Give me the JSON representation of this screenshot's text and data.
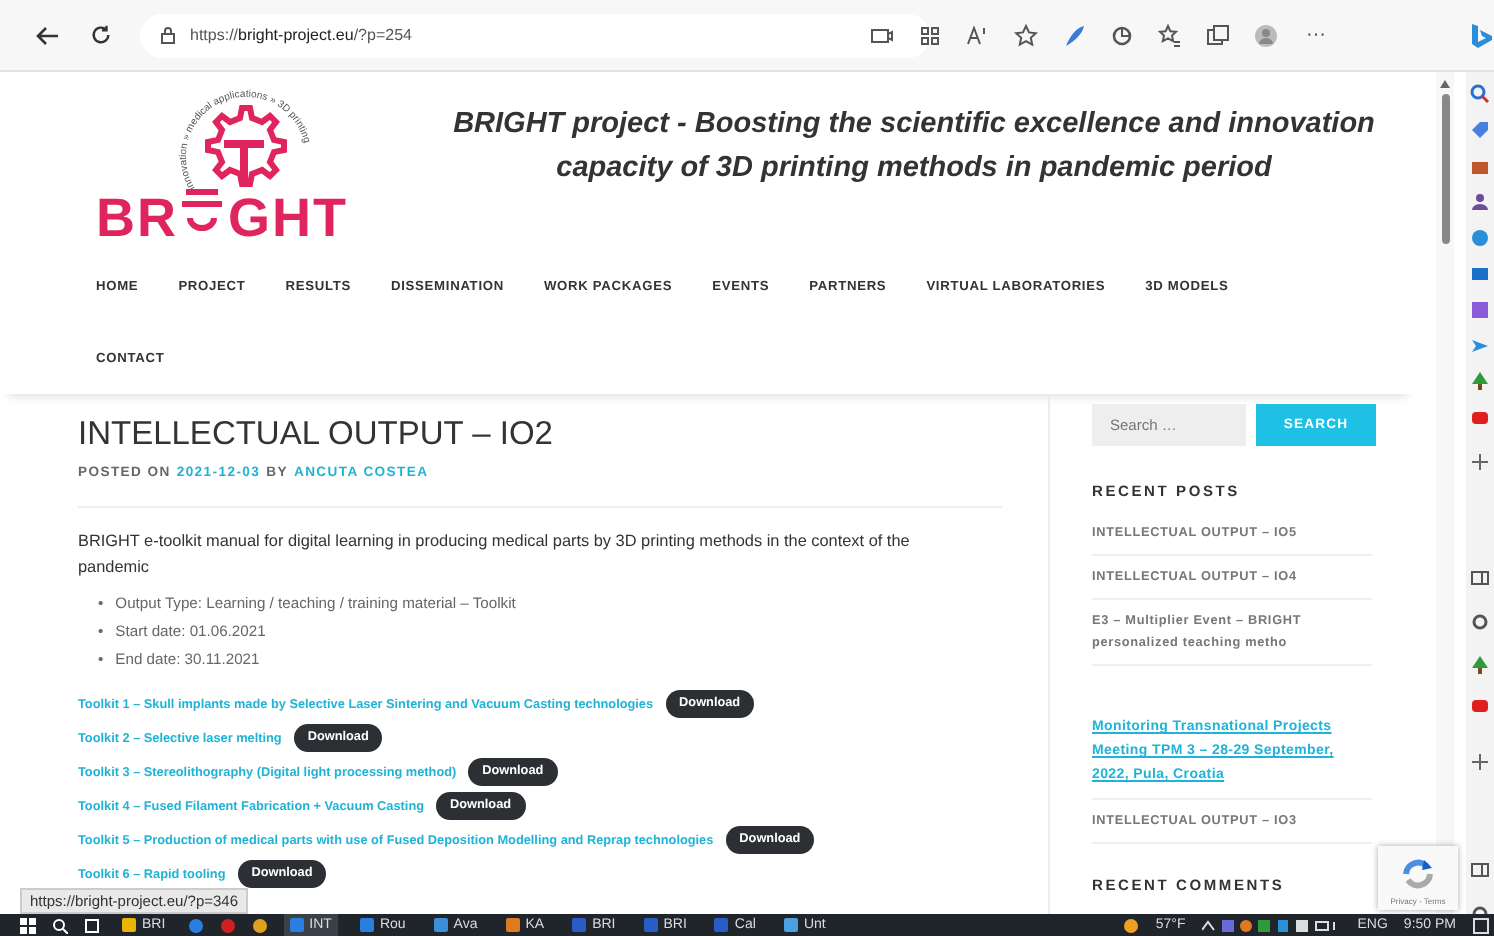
{
  "browser": {
    "url": "https://**bright-project.eu**/?p=254",
    "more": "···"
  },
  "site": {
    "logo": {
      "ring_text": "innovation » medical applications » 3D printing",
      "word_left": "BR",
      "word_right": "GHT"
    },
    "title_lines": [
      "BRIGHT project - Boosting the scientific excellence and innovation",
      "capacity of 3D printing methods in pandemic period"
    ]
  },
  "nav": [
    "HOME",
    "PROJECT",
    "RESULTS",
    "DISSEMINATION",
    "WORK PACKAGES",
    "EVENTS",
    "PARTNERS",
    "VIRTUAL LABORATORIES",
    "3D MODELS",
    "CONTACT"
  ],
  "article": {
    "title": "INTELLECTUAL OUTPUT – IO2",
    "posted_on": "POSTED ON",
    "date": "2021-12-03",
    "by": "BY",
    "author": "ANCUTA COSTEA",
    "intro": "BRIGHT e-toolkit manual for digital learning in producing medical parts by 3D printing methods in the context of the pandemic",
    "bullets": [
      {
        "marker": "•",
        "text": "Output Type: Learning / teaching / training material – Toolkit"
      },
      {
        "marker": "•",
        "text": "Start date: 01.06.2021"
      },
      {
        "marker": "•",
        "text": "End date: 30.11.2021"
      }
    ],
    "toolkits": [
      {
        "label": "Toolkit 1 – Skull implants made by Selective Laser Sintering and Vacuum Casting technologies",
        "button": "Download"
      },
      {
        "label": "Toolkit 2 – Selective laser melting",
        "button": "Download"
      },
      {
        "label": "Toolkit 3 – Stereolithography (Digital light processing method)",
        "button": "Download"
      },
      {
        "label": "Toolkit 4 – Fused Filament Fabrication + Vacuum Casting",
        "button": "Download"
      },
      {
        "label": "Toolkit 5 – Production of medical parts with use of Fused Deposition Modelling and Reprap technologies",
        "button": "Download"
      },
      {
        "label": "Toolkit 6 – Rapid tooling",
        "button": "Download"
      }
    ]
  },
  "sidebar": {
    "search": {
      "placeholder": "Search …",
      "button": "SEARCH"
    },
    "recent_posts_title": "RECENT POSTS",
    "recent_posts": [
      {
        "label": "INTELLECTUAL OUTPUT – IO5",
        "kind": "plain"
      },
      {
        "label": "INTELLECTUAL OUTPUT – IO4",
        "kind": "plain"
      },
      {
        "label": "E3 – Multiplier Event – BRIGHT\npersonalized teaching metho",
        "kind": "plain"
      },
      {
        "label": "Monitoring Transnational Projects Meeting TPM 3 – 28-29 September, 2022, Pula, Croatia",
        "kind": "link"
      },
      {
        "label": "INTELLECTUAL OUTPUT – IO3",
        "kind": "plain"
      }
    ],
    "recent_comments_title": "RECENT COMMENTS",
    "recaptcha": "Privacy - Terms"
  },
  "status_url": "https://bright-project.eu/?p=346",
  "taskbar": {
    "apps": [
      "BRI",
      "INT",
      "Rou",
      "Ava",
      "KA",
      "BRI",
      "BRI",
      "Cal",
      "Unt"
    ],
    "weather": "57°F",
    "language": "ENG",
    "time": "9:50 PM"
  }
}
